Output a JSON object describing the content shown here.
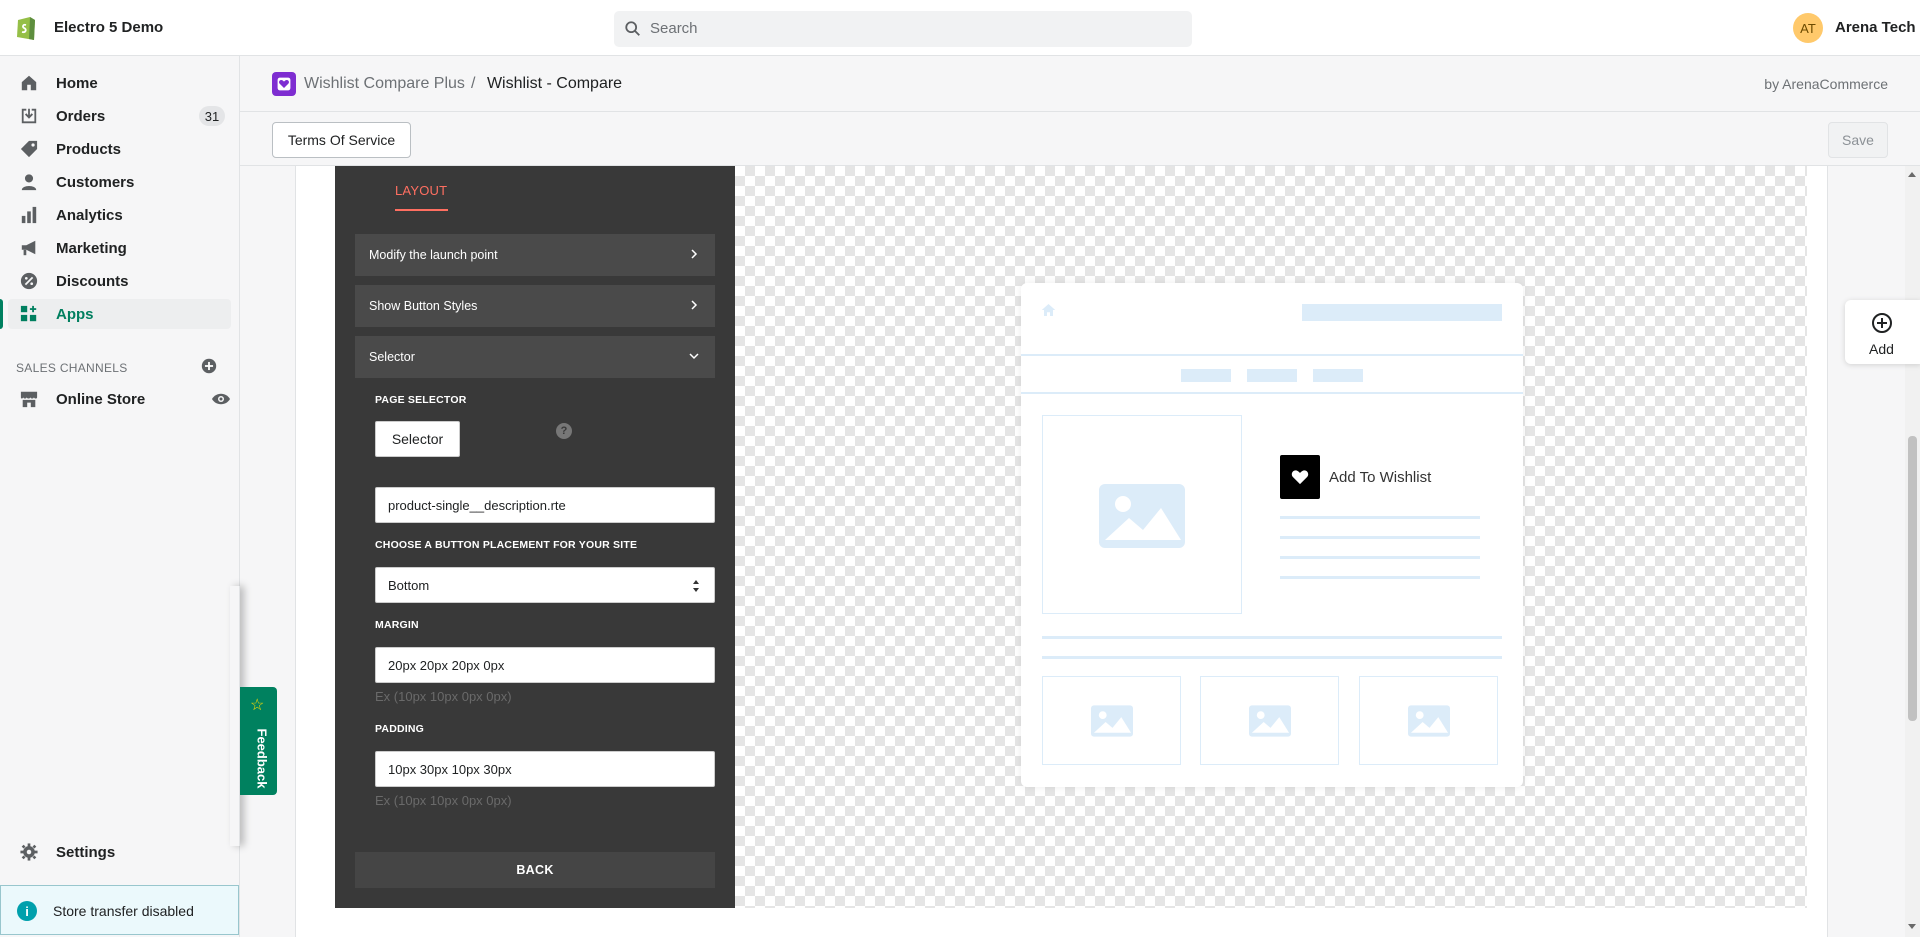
{
  "topbar": {
    "store_name": "Electro 5 Demo",
    "search_placeholder": "Search",
    "avatar_initials": "AT",
    "user_name": "Arena Tech"
  },
  "sidebar": {
    "items": [
      {
        "label": "Home",
        "icon": "home-icon"
      },
      {
        "label": "Orders",
        "icon": "orders-icon",
        "badge": "31"
      },
      {
        "label": "Products",
        "icon": "tag-icon"
      },
      {
        "label": "Customers",
        "icon": "person-icon"
      },
      {
        "label": "Analytics",
        "icon": "bar-chart-icon"
      },
      {
        "label": "Marketing",
        "icon": "megaphone-icon"
      },
      {
        "label": "Discounts",
        "icon": "discount-icon"
      },
      {
        "label": "Apps",
        "icon": "apps-icon",
        "active": true
      }
    ],
    "sales_channels_title": "SALES CHANNELS",
    "online_store": "Online Store",
    "settings": "Settings",
    "store_transfer": "Store transfer disabled"
  },
  "app_header": {
    "app_name": "Wishlist Compare Plus",
    "separator": "/",
    "page": "Wishlist - Compare",
    "by": "by ArenaCommerce"
  },
  "actions": {
    "terms": "Terms Of Service",
    "save": "Save"
  },
  "panel": {
    "tab": "LAYOUT",
    "accordions": [
      "Modify the launch point",
      "Show Button Styles",
      "Selector"
    ],
    "page_selector_label": "PAGE SELECTOR",
    "selector_button": "Selector",
    "selector_value": "product-single__description.rte",
    "placement_label": "CHOOSE A BUTTON PLACEMENT FOR YOUR SITE",
    "placement_value": "Bottom",
    "margin_label": "MARGIN",
    "margin_value": "20px 20px 20px 0px",
    "margin_hint": "Ex (10px 10px 0px 0px)",
    "padding_label": "PADDING",
    "padding_value": "10px 30px 10px 30px",
    "padding_hint": "Ex (10px 10px 0px 0px)",
    "back": "BACK"
  },
  "preview": {
    "wishlist_label": "Add To Wishlist"
  },
  "floating": {
    "add": "Add",
    "feedback": "Feedback"
  },
  "colors": {
    "accent_green": "#008060",
    "tab_active": "#ff6f61",
    "panel_bg": "#393939",
    "app_logo": "#7e2dd1"
  }
}
